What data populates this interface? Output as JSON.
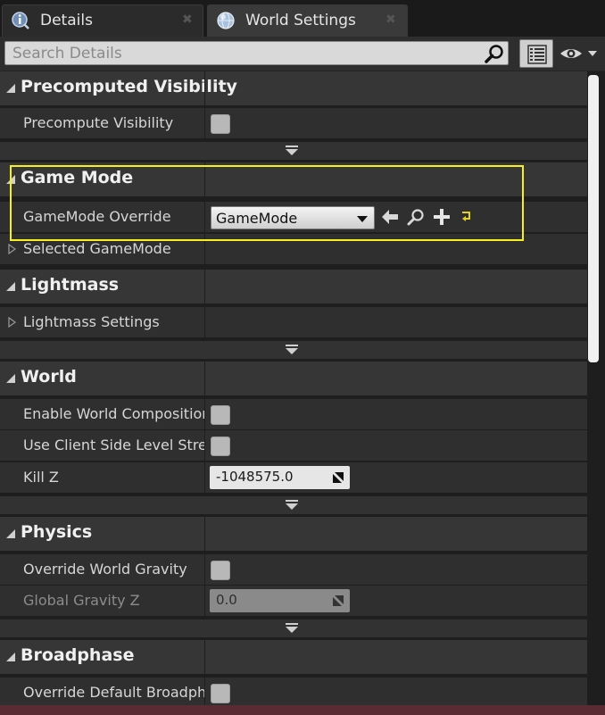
{
  "tabs": [
    {
      "label": "Details",
      "icon": "info-icon",
      "active": false
    },
    {
      "label": "World Settings",
      "icon": "globe-icon",
      "active": true
    }
  ],
  "search": {
    "placeholder": "Search Details"
  },
  "categories": {
    "precomputed_visibility": "Precomputed Visibility",
    "game_mode": "Game Mode",
    "lightmass": "Lightmass",
    "world": "World",
    "physics": "Physics",
    "broadphase": "Broadphase"
  },
  "properties": {
    "precompute_visibility": "Precompute Visibility",
    "gamemode_override": "GameMode Override",
    "gamemode_value": "GameMode",
    "selected_gamemode": "Selected GameMode",
    "lightmass_settings": "Lightmass Settings",
    "enable_world_composition": "Enable World Composition",
    "use_client_side_level_stream": "Use Client Side Level Stream",
    "kill_z": "Kill Z",
    "kill_z_value": "-1048575.0",
    "override_world_gravity": "Override World Gravity",
    "global_gravity_z": "Global Gravity Z",
    "global_gravity_z_value": "0.0",
    "override_default_broadphase": "Override Default Broadphase"
  },
  "colors": {
    "highlight": "#f5f01e",
    "panel_bg": "#2f2f2f",
    "category_bg": "#363636"
  }
}
